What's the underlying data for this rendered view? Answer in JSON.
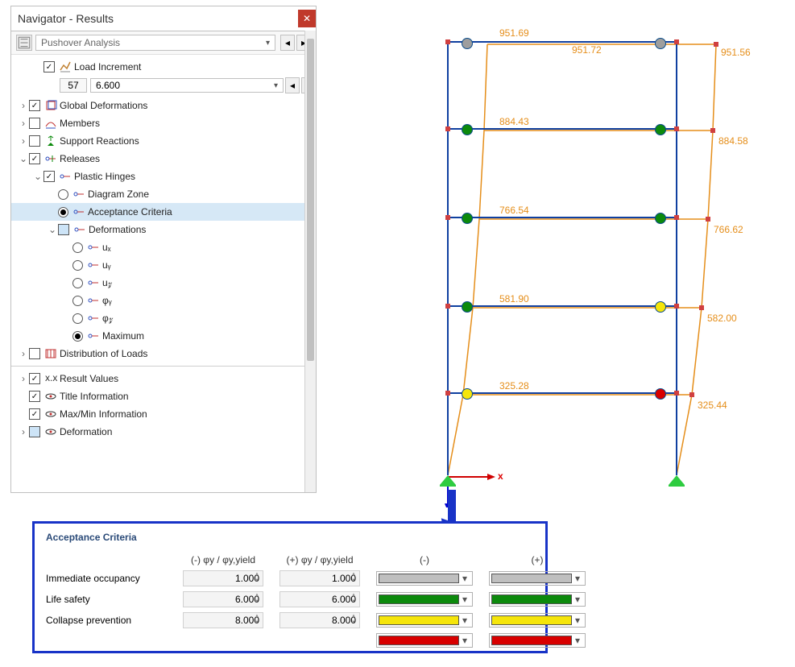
{
  "navigator": {
    "title": "Navigator - Results",
    "analysis_type": "Pushover Analysis",
    "load_increment": {
      "label": "Load Increment",
      "step": "57",
      "value": "6.600"
    },
    "tree": {
      "global_deformations": "Global Deformations",
      "members": "Members",
      "support_reactions": "Support Reactions",
      "releases": "Releases",
      "plastic_hinges": "Plastic Hinges",
      "diagram_zone": "Diagram Zone",
      "acceptance_criteria": "Acceptance Criteria",
      "deformations": "Deformations",
      "ux": "uₓ",
      "uy": "uᵧ",
      "uz": "u𝓏",
      "phiy": "φᵧ",
      "phiz": "φ𝓏",
      "maximum": "Maximum",
      "distribution_loads": "Distribution of Loads",
      "result_values": "Result Values",
      "title_info": "Title Information",
      "maxmin_info": "Max/Min Information",
      "deformation": "Deformation"
    }
  },
  "diagram": {
    "axis_x": "x",
    "labels": {
      "r0_mid": "951.69",
      "r0_right": "951.72",
      "r0_far": "951.56",
      "r1_mid": "884.43",
      "r1_far": "884.58",
      "r2_mid": "766.54",
      "r2_far": "766.62",
      "r3_mid": "581.90",
      "r3_far": "582.00",
      "r4_mid": "325.28",
      "r4_far": "325.44"
    }
  },
  "acceptance": {
    "title": "Acceptance Criteria",
    "col_neg": "(-) φy / φy,yield",
    "col_pos": "(+) φy / φy,yield",
    "sign_neg": "(-)",
    "sign_pos": "(+)",
    "rows": {
      "io": {
        "label": "Immediate occupancy",
        "neg": "1.000",
        "pos": "1.000"
      },
      "ls": {
        "label": "Life safety",
        "neg": "6.000",
        "pos": "6.000"
      },
      "cp": {
        "label": "Collapse prevention",
        "neg": "8.000",
        "pos": "8.000"
      }
    }
  }
}
